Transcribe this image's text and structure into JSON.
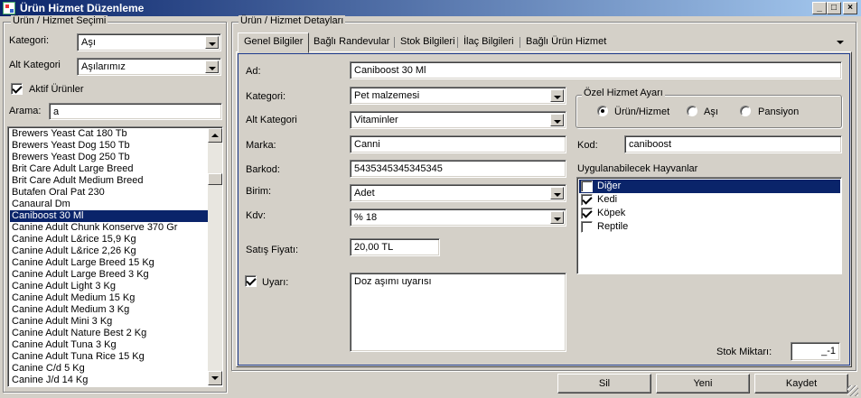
{
  "window": {
    "title": "Ürün Hizmet Düzenleme",
    "minimize": "_",
    "maximize": "□",
    "close": "×"
  },
  "left_panel": {
    "group_title": "Ürün / Hizmet Seçimi",
    "kategori_label": "Kategori:",
    "kategori_value": "Aşı",
    "alt_kategori_label": "Alt Kategori",
    "alt_kategori_value": "Aşılarımız",
    "aktif_urunler_label": "Aktif Ürünler",
    "arama_label": "Arama:",
    "arama_value": "a",
    "products": [
      "Brewers Yeast Cat 180 Tb",
      "Brewers Yeast Dog 150 Tb",
      "Brewers Yeast Dog 250 Tb",
      "Brit Care Adult Large Breed",
      "Brit Care Adult Medium Breed",
      "Butafen Oral Pat 230",
      "Canaural Dm",
      "Caniboost 30 Ml",
      "Canine Adult Chunk Konserve 370 Gr",
      "Canine Adult L&rice 15,9 Kg",
      "Canine Adult L&rice 2,26 Kg",
      "Canine Adult Large Breed 15 Kg",
      "Canine Adult Large Breed 3 Kg",
      "Canine Adult Light 3 Kg",
      "Canine Adult Medium 15 Kg",
      "Canine Adult Medium 3 Kg",
      "Canine Adult Mini 3 Kg",
      "Canine Adult Nature Best 2 Kg",
      "Canine Adult Tuna 3 Kg",
      "Canine Adult Tuna Rice 15 Kg",
      "Canine C/d 5 Kg",
      "Canine J/d 14 Kg"
    ],
    "selected_product": "Caniboost 30 Ml"
  },
  "right_panel": {
    "group_title": "Ürün / Hizmet Detayları",
    "tabs": [
      "Genel Bilgiler",
      "Bağlı Randevular",
      "Stok Bilgileri",
      "İlaç Bilgileri",
      "Bağlı Ürün Hizmet"
    ],
    "active_tab": "Genel Bilgiler",
    "ad_label": "Ad:",
    "ad_value": "Caniboost 30 Ml",
    "kategori_label": "Kategori:",
    "kategori_value": "Pet malzemesi",
    "alt_kategori_label": "Alt Kategori",
    "alt_kategori_value": "Vitaminler",
    "marka_label": "Marka:",
    "marka_value": "Canni",
    "barkod_label": "Barkod:",
    "barkod_value": "5435345345345345",
    "birim_label": "Birim:",
    "birim_value": "Adet",
    "kdv_label": "Kdv:",
    "kdv_value": "% 18",
    "satis_fiyati_label": "Satış Fiyatı:",
    "satis_fiyati_value": "20,00 TL",
    "uyari_label": "Uyarı:",
    "uyari_value": "Doz aşımı uyarısı",
    "ozel_hizmet_title": "Özel Hizmet Ayarı",
    "radios": [
      "Ürün/Hizmet",
      "Aşı",
      "Pansiyon"
    ],
    "radio_selected": "Ürün/Hizmet",
    "kod_label": "Kod:",
    "kod_value": "caniboost",
    "hayvanlar_label": "Uygulanabilecek Hayvanlar",
    "animals": [
      {
        "name": "Diğer",
        "checked": false,
        "highlighted": true
      },
      {
        "name": "Kedi",
        "checked": true,
        "highlighted": false
      },
      {
        "name": "Köpek",
        "checked": true,
        "highlighted": false
      },
      {
        "name": "Reptile",
        "checked": false,
        "highlighted": false
      }
    ],
    "stok_miktari_label": "Stok Miktarı:",
    "stok_miktari_value": "_-1"
  },
  "buttons": {
    "sil": "Sil",
    "yeni": "Yeni",
    "kaydet": "Kaydet"
  }
}
